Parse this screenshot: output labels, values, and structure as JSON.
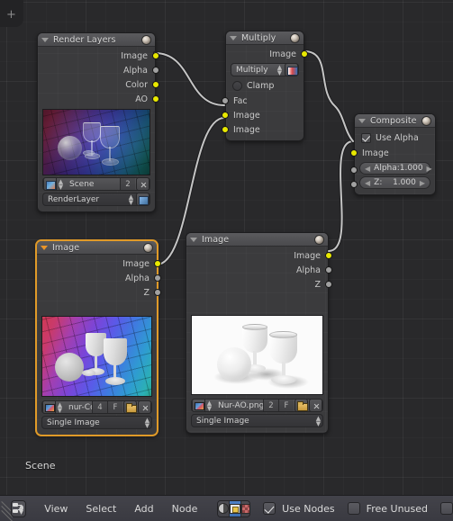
{
  "app": {
    "editor": "Node Editor",
    "scene_label": "Scene"
  },
  "nodes": {
    "render_layers": {
      "title": "Render Layers",
      "outputs": [
        "Image",
        "Alpha",
        "Color",
        "AO"
      ],
      "scene_field": "Scene",
      "scene_users": "2",
      "layer_field": "RenderLayer"
    },
    "multiply": {
      "title": "Multiply",
      "outputs": [
        "Image"
      ],
      "blend_mode": "Multiply",
      "clamp_label": "Clamp",
      "inputs": [
        "Fac",
        "Image",
        "Image"
      ]
    },
    "composite": {
      "title": "Composite",
      "use_alpha_label": "Use Alpha",
      "image_input": "Image",
      "alpha_label": "Alpha:",
      "alpha_value": "1.000",
      "z_label": "Z:",
      "z_value": "1.000"
    },
    "image_color": {
      "title": "Image",
      "outputs": [
        "Image",
        "Alpha",
        "Z"
      ],
      "filename": "nur-Color.png",
      "users": "4",
      "fake_user": "F",
      "source": "Single Image"
    },
    "image_ao": {
      "title": "Image",
      "outputs": [
        "Image",
        "Alpha",
        "Z"
      ],
      "filename": "Nur-AO.png",
      "users": "2",
      "fake_user": "F",
      "source": "Single Image"
    }
  },
  "footer": {
    "menus": [
      "View",
      "Select",
      "Add",
      "Node"
    ],
    "toggles": [
      {
        "name": "material-nodes",
        "active": false
      },
      {
        "name": "compositing-nodes",
        "active": true
      },
      {
        "name": "texture-nodes",
        "active": false
      }
    ],
    "use_nodes_label": "Use Nodes",
    "use_nodes_checked": true,
    "free_unused_label": "Free Unused",
    "free_unused_checked": false,
    "backdrop_checked": false
  },
  "colors": {
    "socket_image": "#e8e800",
    "socket_value": "#a1a1a1",
    "selected_outline": "#e09a28",
    "active_toggle": "#3b6cb0",
    "node_body": "#3b3b3d",
    "canvas": "#29292b"
  }
}
